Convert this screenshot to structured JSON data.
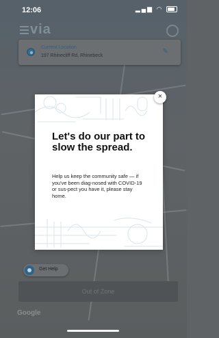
{
  "status_bar": {
    "time": "12:06",
    "signal_icon": "signal-bars-icon",
    "wifi_icon": "wifi-icon",
    "battery_icon": "battery-icon"
  },
  "header": {
    "menu_icon": "menu-icon",
    "logo": "via",
    "profile_icon": "profile-icon"
  },
  "location": {
    "title": "Current Location",
    "address": "197 Rhinecliff Rd, Rhinebeck",
    "pin_icon": "location-pin-icon",
    "edit_icon": "pencil-icon"
  },
  "modal": {
    "headline": "Let's do our part to slow the spread.",
    "body": "Help us keep the community safe — if you've been diag-nosed with COVID-19 or sus-pect you have it, please stay home.",
    "close_label": "×"
  },
  "help": {
    "label": "Get Help",
    "icon": "help-icon"
  },
  "zone_button": {
    "label": "Out of Zone"
  },
  "map": {
    "attribution": "Google"
  },
  "colors": {
    "accent": "#2f6489",
    "overlay": "#5f6366",
    "modal_bg": "#ffffff"
  }
}
